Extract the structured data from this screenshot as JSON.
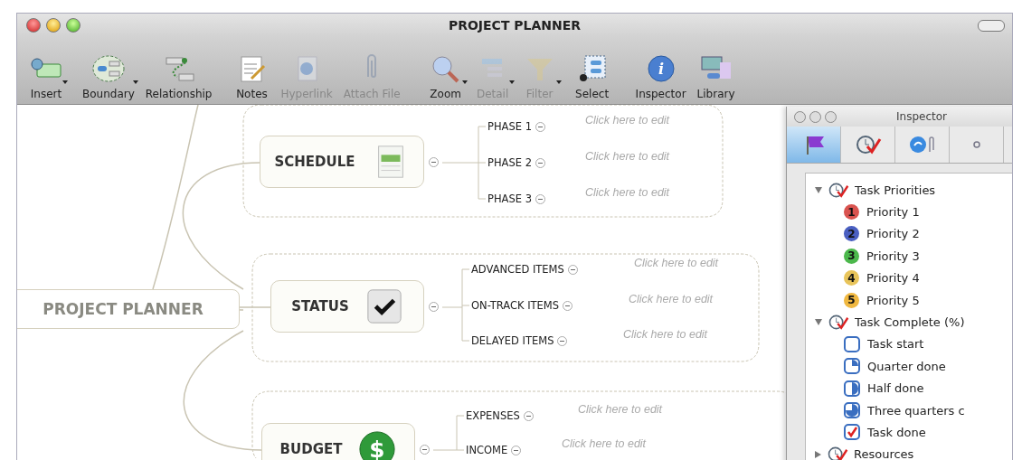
{
  "window": {
    "title": "PROJECT PLANNER"
  },
  "toolbar": [
    {
      "label": "Insert",
      "kind": "insert",
      "menu": true,
      "disabled": false
    },
    {
      "label": "Boundary",
      "kind": "boundary",
      "menu": true,
      "disabled": false
    },
    {
      "label": "Relationship",
      "kind": "relationship",
      "menu": false,
      "disabled": false
    },
    {
      "label": "Notes",
      "kind": "notes",
      "menu": false,
      "disabled": false
    },
    {
      "label": "Hyperlink",
      "kind": "hyperlink",
      "menu": false,
      "disabled": true
    },
    {
      "label": "Attach File",
      "kind": "attach",
      "menu": false,
      "disabled": true
    },
    {
      "label": "Zoom",
      "kind": "zoom",
      "menu": true,
      "disabled": false
    },
    {
      "label": "Detail",
      "kind": "detail",
      "menu": true,
      "disabled": true
    },
    {
      "label": "Filter",
      "kind": "filter",
      "menu": true,
      "disabled": true
    },
    {
      "label": "Select",
      "kind": "select",
      "menu": false,
      "disabled": false
    },
    {
      "label": "Inspector",
      "kind": "inspector",
      "menu": false,
      "disabled": false,
      "glyph": "i"
    },
    {
      "label": "Library",
      "kind": "library",
      "menu": false,
      "disabled": false
    }
  ],
  "map": {
    "root": "PROJECT PLANNER",
    "topics": [
      {
        "label": "SCHEDULE",
        "kind": "calendar",
        "children": [
          {
            "label": "PHASE 1",
            "note": "Click here to edit"
          },
          {
            "label": "PHASE 2",
            "note": "Click here to edit"
          },
          {
            "label": "PHASE 3",
            "note": "Click here to edit"
          }
        ]
      },
      {
        "label": "STATUS",
        "kind": "check",
        "children": [
          {
            "label": "ADVANCED ITEMS",
            "note": "Click here to edit"
          },
          {
            "label": "ON-TRACK ITEMS",
            "note": "Click here to edit"
          },
          {
            "label": "DELAYED ITEMS",
            "note": "Click here to edit"
          }
        ]
      },
      {
        "label": "BUDGET",
        "kind": "dollar",
        "glyph": "$",
        "children": [
          {
            "label": "EXPENSES",
            "note": "Click here to edit"
          },
          {
            "label": "INCOME",
            "note": "Click here to edit"
          }
        ]
      }
    ]
  },
  "inspector": {
    "title": "Inspector",
    "tabs": [
      {
        "kind": "flag",
        "selected": true
      },
      {
        "kind": "task",
        "selected": false
      },
      {
        "kind": "link",
        "selected": false
      },
      {
        "kind": "more",
        "selected": false
      }
    ],
    "groups": [
      {
        "label": "Task Priorities",
        "expanded": true,
        "items": [
          {
            "label": "Priority 1",
            "kind": "priority",
            "badge": "1",
            "color": "#d9534f"
          },
          {
            "label": "Priority 2",
            "kind": "priority",
            "badge": "2",
            "color": "#4a5fc1"
          },
          {
            "label": "Priority 3",
            "kind": "priority",
            "badge": "3",
            "color": "#4cb84c"
          },
          {
            "label": "Priority 4",
            "kind": "priority",
            "badge": "4",
            "color": "#e8c45a"
          },
          {
            "label": "Priority 5",
            "kind": "priority",
            "badge": "5",
            "color": "#f0b840"
          }
        ]
      },
      {
        "label": "Task Complete (%)",
        "expanded": true,
        "items": [
          {
            "label": "Task start",
            "kind": "start"
          },
          {
            "label": "Quarter done",
            "kind": "quarter"
          },
          {
            "label": "Half done",
            "kind": "half"
          },
          {
            "label": "Three quarters c",
            "kind": "three-quarters"
          },
          {
            "label": "Task done",
            "kind": "done"
          }
        ]
      },
      {
        "label": "Resources",
        "expanded": false
      }
    ]
  }
}
